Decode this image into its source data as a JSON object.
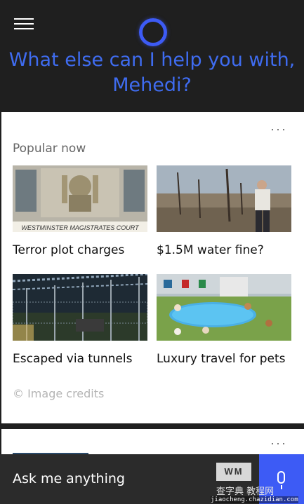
{
  "header": {
    "greeting_line1": "What else can I help you with,",
    "greeting_line2": "Mehedi?"
  },
  "card": {
    "more": "···",
    "section_title": "Popular now",
    "tiles": [
      {
        "caption": "Terror plot charges",
        "image_text": "WESTMINSTER MAGISTRATES COURT"
      },
      {
        "caption": "$1.5M water fine?"
      },
      {
        "caption": "Escaped via tunnels"
      },
      {
        "caption": "Luxury travel for pets"
      }
    ],
    "credits": "© Image credits"
  },
  "card2": {
    "more": "···"
  },
  "askbar": {
    "placeholder": "Ask me anything"
  },
  "watermark": {
    "logo": "WM",
    "line1": "查字典 教程网",
    "line2": "jiaocheng.chazidian.com"
  },
  "colors": {
    "accent": "#3d5bf5",
    "greeting": "#3f6cf0",
    "background": "#1f1f1f"
  }
}
